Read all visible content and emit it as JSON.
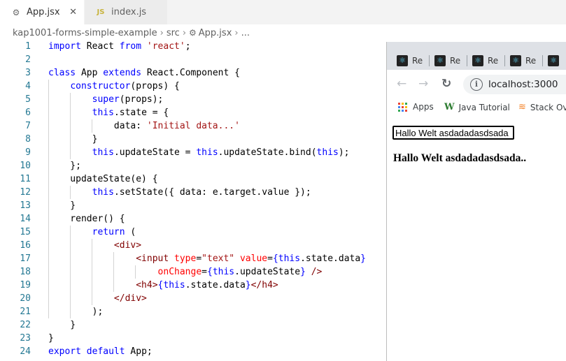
{
  "editor_tabs": [
    {
      "label": "App.jsx",
      "close": "✕"
    },
    {
      "label": "index.js",
      "icon_text": "JS"
    }
  ],
  "breadcrumb": [
    "kap1001-forms-simple-example",
    "src",
    "App.jsx",
    "..."
  ],
  "code_lines": [
    {
      "n": "1",
      "html": "<span class='k'>import</span> React <span class='k'>from</span> <span class='s'>'react'</span>;"
    },
    {
      "n": "2",
      "html": ""
    },
    {
      "n": "3",
      "html": "<span class='k'>class</span> App <span class='k'>extends</span> React.Component {"
    },
    {
      "n": "4",
      "html": "    <span class='k'>constructor</span>(props) {"
    },
    {
      "n": "5",
      "html": "        <span class='k'>super</span>(props);"
    },
    {
      "n": "6",
      "html": "        <span class='k'>this</span>.state = {"
    },
    {
      "n": "7",
      "html": "            data: <span class='s'>'Initial data...'</span>"
    },
    {
      "n": "8",
      "html": "        }"
    },
    {
      "n": "9",
      "html": "        <span class='k'>this</span>.updateState = <span class='k'>this</span>.updateState.bind(<span class='k'>this</span>);"
    },
    {
      "n": "10",
      "html": "    };"
    },
    {
      "n": "11",
      "html": "    updateState(e) {"
    },
    {
      "n": "12",
      "html": "        <span class='k'>this</span>.setState({ data: e.target.value });"
    },
    {
      "n": "13",
      "html": "    }"
    },
    {
      "n": "14",
      "html": "    render() {"
    },
    {
      "n": "15",
      "html": "        <span class='k'>return</span> ("
    },
    {
      "n": "16",
      "html": "            <span class='t'>&lt;div&gt;</span>"
    },
    {
      "n": "17",
      "html": "                <span class='t'>&lt;input</span> <span class='a'>type</span>=<span class='s'>\"text\"</span> <span class='a'>value</span>=<span class='k'>{this</span>.state.data<span class='k'>}</span>"
    },
    {
      "n": "18",
      "html": "                    <span class='a'>onChange</span>=<span class='k'>{this</span>.updateState<span class='k'>}</span> <span class='t'>/&gt;</span>"
    },
    {
      "n": "19",
      "html": "                <span class='t'>&lt;h4&gt;</span><span class='k'>{this</span>.state.data<span class='k'>}</span><span class='t'>&lt;/h4&gt;</span>"
    },
    {
      "n": "20",
      "html": "            <span class='t'>&lt;/div&gt;</span>"
    },
    {
      "n": "21",
      "html": "        );"
    },
    {
      "n": "22",
      "html": "    }"
    },
    {
      "n": "23",
      "html": "}"
    },
    {
      "n": "24",
      "html": "<span class='k'>export</span> <span class='k'>default</span> App;"
    }
  ],
  "browser": {
    "tab_label": "Re",
    "tab_count": 5,
    "url": "localhost:3000",
    "bookmarks": [
      {
        "label": "Apps"
      },
      {
        "label": "Java Tutorial"
      },
      {
        "label": "Stack Ov"
      }
    ],
    "input_value": "Hallo Welt asdadadasdsada",
    "heading_text": "Hallo Welt asdadadasdsada.."
  },
  "colors": {
    "keyword": "#0000ff",
    "string": "#a31515",
    "tag": "#800000",
    "attribute": "#ff0000",
    "line_number": "#237893"
  }
}
